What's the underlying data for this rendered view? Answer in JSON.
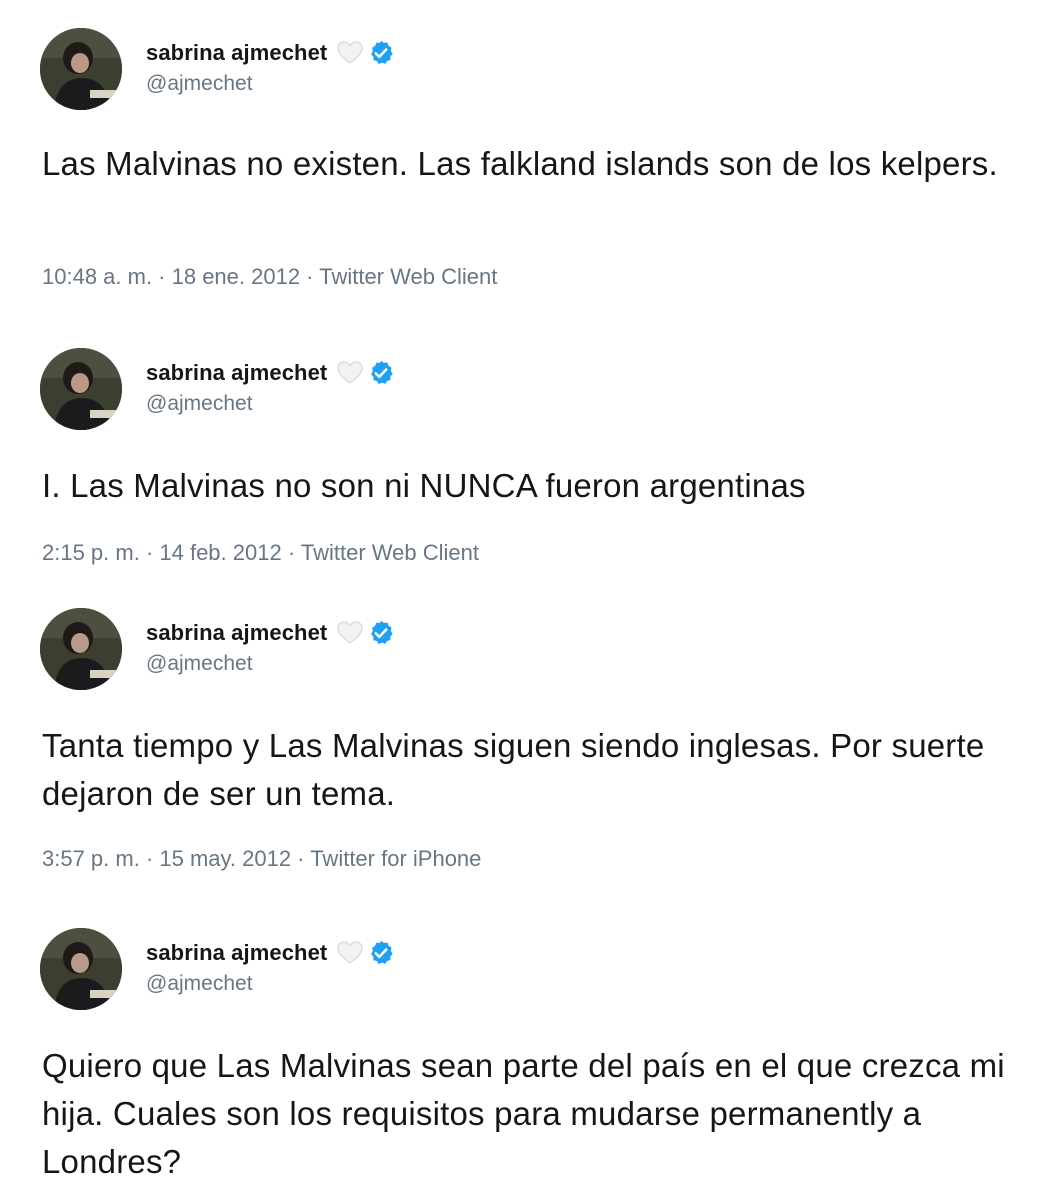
{
  "colors": {
    "verified_badge": "#1da1f2",
    "secondary_text": "#657786",
    "primary_text": "#14171a"
  },
  "icons": {
    "heart": "white-heart-icon",
    "verified": "verified-badge-icon"
  },
  "tweets": [
    {
      "display_name": "sabrina ajmechet",
      "handle": "@ajmechet",
      "text": "Las Malvinas no existen. Las falkland islands son de los kelpers.",
      "meta": "10:48 a. m. · 18 ene. 2012 · Twitter Web Client"
    },
    {
      "display_name": "sabrina ajmechet",
      "handle": "@ajmechet",
      "text": "I. Las Malvinas no son ni NUNCA fueron argentinas",
      "meta": "2:15 p. m. · 14 feb. 2012 · Twitter Web Client"
    },
    {
      "display_name": "sabrina ajmechet",
      "handle": "@ajmechet",
      "text": "Tanta tiempo y Las Malvinas siguen siendo inglesas. Por suerte dejaron de ser un tema.",
      "meta": "3:57 p. m. · 15 may. 2012 · Twitter for iPhone"
    },
    {
      "display_name": "sabrina ajmechet",
      "handle": "@ajmechet",
      "text": "Quiero que Las Malvinas sean parte del país en el que crezca mi hija. Cuales son los requisitos para mudarse permanently a Londres?",
      "meta": ""
    }
  ]
}
